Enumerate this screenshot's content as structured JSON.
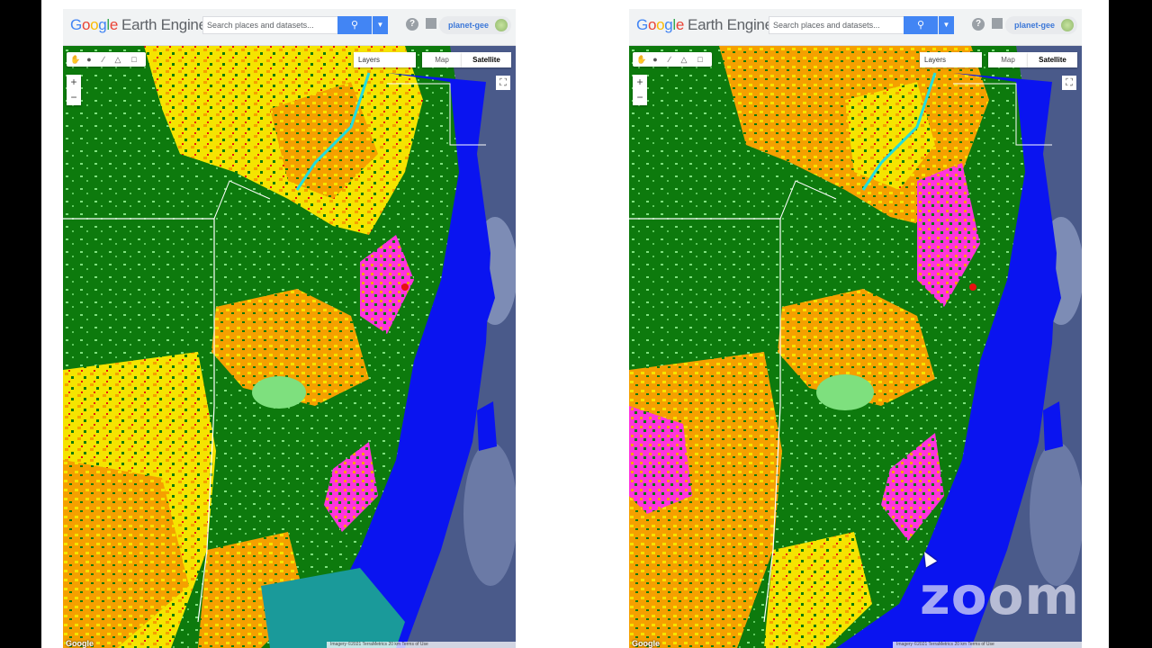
{
  "panels": [
    {
      "id": "left",
      "app": {
        "logo_google": [
          "G",
          "o",
          "o",
          "g",
          "l",
          "e"
        ],
        "logo_product": "Earth Engine"
      },
      "search": {
        "placeholder": "Search places and datasets..."
      },
      "account": {
        "name": "planet-gee"
      },
      "map_controls": {
        "layers_label": "Layers",
        "map_label": "Map",
        "satellite_label": "Satellite",
        "zoom_in": "+",
        "zoom_out": "−"
      },
      "footer": {
        "attribution": "Imagery ©2021 TerraMetrics  20 km  Terms of Use",
        "google_mark": "Google"
      }
    },
    {
      "id": "right",
      "app": {
        "logo_google": [
          "G",
          "o",
          "o",
          "g",
          "l",
          "e"
        ],
        "logo_product": "Earth Engine"
      },
      "search": {
        "placeholder": "Search places and datasets..."
      },
      "account": {
        "name": "planet-gee"
      },
      "map_controls": {
        "layers_label": "Layers",
        "map_label": "Map",
        "satellite_label": "Satellite",
        "zoom_in": "+",
        "zoom_out": "−"
      },
      "footer": {
        "attribution": "Imagery ©2021 TerraMetrics  20 km  Terms of Use",
        "google_mark": "Google"
      }
    }
  ],
  "overlay": {
    "watermark": "zoom"
  },
  "colors": {
    "forest": "#0d7a0d",
    "crop_yellow": "#f5e400",
    "crop_orange": "#f5a000",
    "water": "#0a14f0",
    "magenta": "#ff33dd",
    "red": "#e81010",
    "light_green": "#7ee07e",
    "cyan": "#22dddd",
    "sea_satellite": "#4a5a8a"
  }
}
